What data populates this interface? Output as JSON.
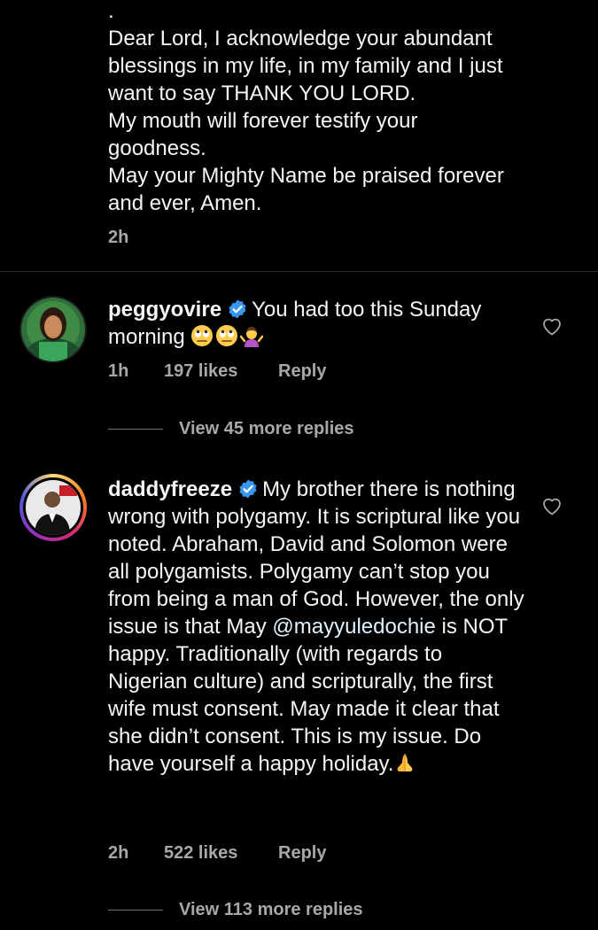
{
  "top_comment": {
    "dot": ".",
    "text": "Dear Lord, I acknowledge your abundant\nblessings in my life, in my family and I just\nwant to say THANK YOU LORD.\nMy mouth will forever testify your\ngoodness.\nMay your Mighty Name be praised forever\nand ever, Amen.",
    "time": "2h"
  },
  "comments": [
    {
      "username": "peggyovire",
      "text_before": "You had too this Sunday morning ",
      "emojis": [
        "rolling-eyes-emoji",
        "rolling-eyes-emoji",
        "shrugging-woman-emoji"
      ],
      "time": "1h",
      "likes": "197 likes",
      "reply_label": "Reply",
      "view_replies": "View 45 more replies"
    },
    {
      "username": "daddyfreeze",
      "text_before": "My brother there is nothing wrong with polygamy. It is scriptural like you noted. Abraham, David and Solomon were all polygamists. Polygamy can’t stop you from being a man of God. However, the only issue is that May ",
      "mention": "@mayyuledochie",
      "text_after": " is NOT happy. Traditionally (with regards to Nigerian culture) and scripturally, the first wife must consent. May made it clear that she didn’t consent. This is my issue. Do have yourself a happy holiday.",
      "emojis": [
        "folded-hands-emoji"
      ],
      "time": "2h",
      "likes": "522 likes",
      "reply_label": "Reply",
      "view_replies": "View 113 more replies"
    }
  ],
  "colors": {
    "background": "#000000",
    "text": "#f5f5f5",
    "secondary": "#a8a8a8",
    "verified": "#3897f0"
  }
}
